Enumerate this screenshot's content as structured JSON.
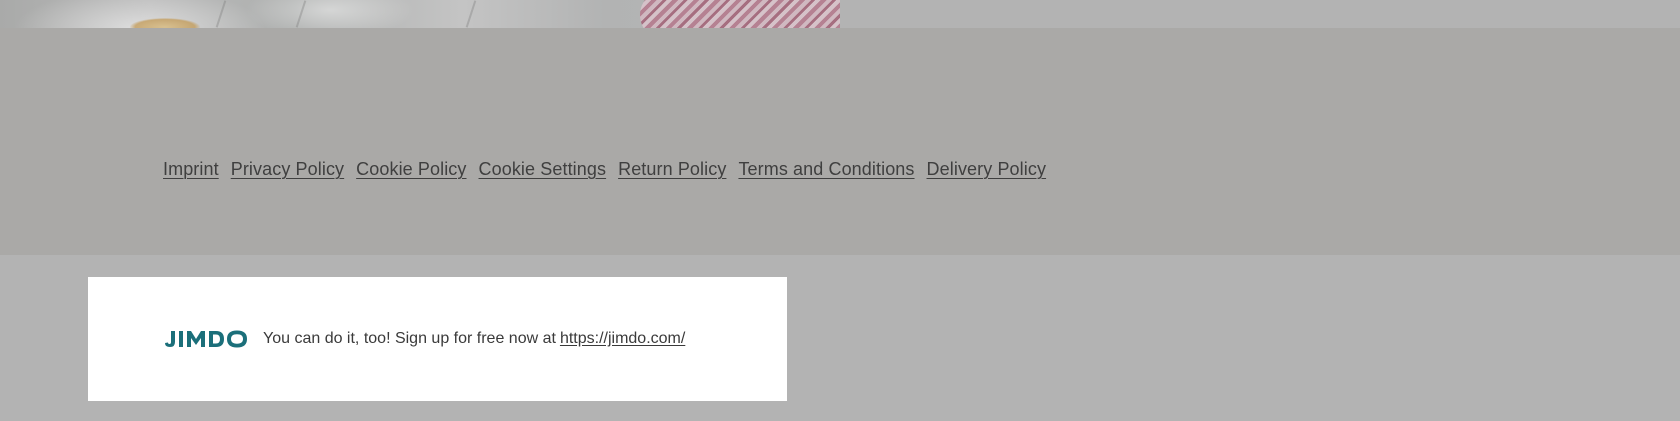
{
  "footer": {
    "links": [
      {
        "label": "Imprint"
      },
      {
        "label": "Privacy Policy"
      },
      {
        "label": "Cookie Policy"
      },
      {
        "label": "Cookie Settings"
      },
      {
        "label": "Return Policy"
      },
      {
        "label": "Terms and Conditions"
      },
      {
        "label": "Delivery Policy"
      }
    ]
  },
  "jimdo_banner": {
    "logo_text": "JIMDO",
    "message": "You can do it, too! Sign up for free now at",
    "link": "https://jimdo.com/",
    "logo_color": "#1b6f7a"
  },
  "colors": {
    "page_background": "#b3b3b3",
    "footer_background": "#aaa9a7",
    "link_text": "#3f3f3f",
    "banner_background": "#ffffff"
  }
}
